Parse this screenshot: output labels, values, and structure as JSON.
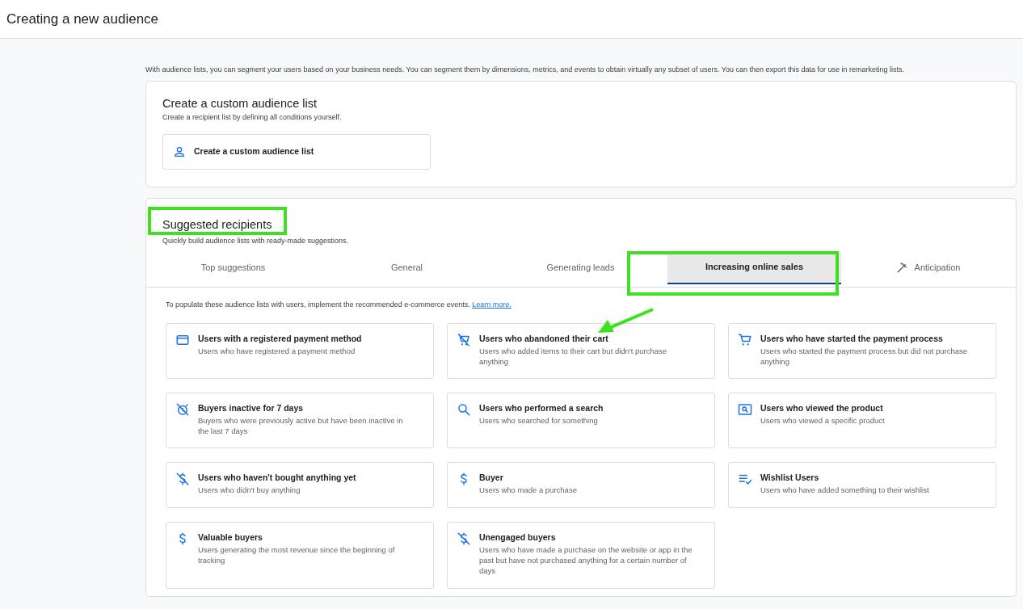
{
  "header": {
    "title": "Creating a new audience"
  },
  "intro": "With audience lists, you can segment your users based on your business needs. You can segment them by dimensions, metrics, and events to obtain virtually any subset of users. You can then export this data for use in remarketing lists.",
  "custom_card": {
    "title": "Create a custom audience list",
    "subtitle": "Create a recipient list by defining all conditions yourself.",
    "button": "Create a custom audience list"
  },
  "suggested": {
    "title": "Suggested recipients",
    "subtitle": "Quickly build audience lists with ready-made suggestions.",
    "tabs": [
      {
        "label": "Top suggestions",
        "selected": false
      },
      {
        "label": "General",
        "selected": false
      },
      {
        "label": "Generating leads",
        "selected": false
      },
      {
        "label": "Increasing online sales",
        "selected": true
      },
      {
        "label": "Anticipation",
        "selected": false
      }
    ],
    "notice": "To populate these audience lists with users, implement the recommended e-commerce events.",
    "notice_link": "Learn more.",
    "cards": [
      {
        "title": "Users with a registered payment method",
        "description": "Users who have registered a payment method"
      },
      {
        "title": "Users who abandoned their cart",
        "description": "Users who added items to their cart but didn't purchase anything"
      },
      {
        "title": "Users who have started the payment process",
        "description": "Users who started the payment process but did not purchase anything"
      },
      {
        "title": "Buyers inactive for 7 days",
        "description": "Buyers who were previously active but have been inactive in the last 7 days"
      },
      {
        "title": "Users who performed a search",
        "description": "Users who searched for something"
      },
      {
        "title": "Users who viewed the product",
        "description": "Users who viewed a specific product"
      },
      {
        "title": "Users who haven't bought anything yet",
        "description": "Users who didn't buy anything"
      },
      {
        "title": "Buyer",
        "description": "Users who made a purchase"
      },
      {
        "title": "Wishlist Users",
        "description": "Users who have added something to their wishlist"
      },
      {
        "title": "Valuable buyers",
        "description": "Users generating the most revenue since the beginning of tracking"
      },
      {
        "title": "Unengaged buyers",
        "description": "Users who have made a purchase on the website or app in the past but have not purchased anything for a certain number of days"
      }
    ]
  }
}
